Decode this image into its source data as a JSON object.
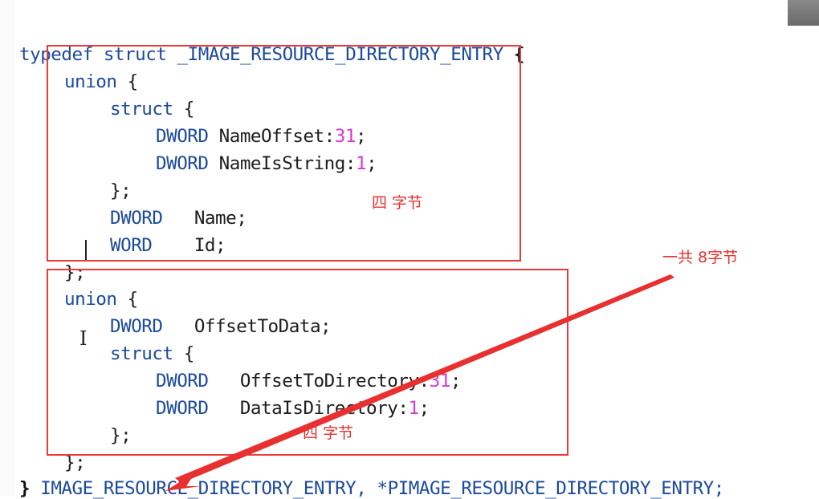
{
  "code": {
    "l1_typedef": "typedef struct",
    "l1_name": "_IMAGE_RESOURCE_DIRECTORY_ENTRY",
    "l1_brace": " {",
    "l2_union": "union",
    "l2_brace": " {",
    "l3_struct": "struct",
    "l3_brace": " {",
    "l4_type": "DWORD",
    "l4_field": " NameOffset:",
    "l4_num": "31",
    "l4_semi": ";",
    "l5_type": "DWORD",
    "l5_field": " NameIsString:",
    "l5_num": "1",
    "l5_semi": ";",
    "l6_close": "};",
    "l7_type": "DWORD",
    "l7_field": "   Name;",
    "l8_type": "WORD",
    "l8_field": "    Id;",
    "l9_close": "};",
    "l10_union": "union",
    "l10_brace": " {",
    "l11_type": "DWORD",
    "l11_field": "   OffsetToData;",
    "l12_struct": "struct",
    "l12_brace": " {",
    "l13_type": "DWORD",
    "l13_field": "   OffsetToDirectory:",
    "l13_num": "31",
    "l13_semi": ";",
    "l14_type": "DWORD",
    "l14_field": "   DataIsDirectory:",
    "l14_num": "1",
    "l14_semi": ";",
    "l15_close": "};",
    "l16_close": "};",
    "l17_brace": "}",
    "l17_rest": " IMAGE_RESOURCE_DIRECTORY_ENTRY, *PIMAGE_RESOURCE_DIRECTORY_ENTRY;"
  },
  "annotations": {
    "box1_note": "四 字节",
    "box2_note": "四 字节",
    "total_note": "一共 8字节"
  },
  "colors": {
    "annotation_red": "#e83030",
    "keyword_blue": "#1c4a9c",
    "number_magenta": "#d63ad6"
  }
}
